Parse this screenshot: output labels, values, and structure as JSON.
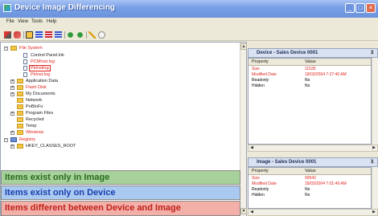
{
  "window": {
    "title": "Device Image Differencing",
    "minimize_glyph": "_",
    "maximize_glyph": "□",
    "close_glyph": "×"
  },
  "menu": [
    "File",
    "View",
    "Tools",
    "Help"
  ],
  "toolbar_icons": [
    "cut-icon",
    "undo-icon",
    "compare-icon",
    "view-list-icon",
    "view-detail-icon",
    "view-tree-icon",
    "sync-icon",
    "export-icon",
    "refresh-icon",
    "help-icon"
  ],
  "tree": {
    "items": [
      {
        "label": "File System",
        "kind": "folder",
        "level": 0,
        "expander": "−",
        "color": "red"
      },
      {
        "label": "Control Panel.lnk",
        "kind": "file",
        "level": 2,
        "color": "normal"
      },
      {
        "label": "PCMInst.log",
        "kind": "file",
        "level": 2,
        "color": "red"
      },
      {
        "label": "PkInstlog",
        "kind": "file",
        "level": 2,
        "color": "selected"
      },
      {
        "label": "PkInst.log",
        "kind": "file",
        "level": 2,
        "color": "red"
      },
      {
        "label": "Application Data",
        "kind": "folder",
        "level": 1,
        "expander": "+",
        "color": "normal"
      },
      {
        "label": "Flash Disk",
        "kind": "folder",
        "level": 1,
        "expander": "+",
        "color": "red"
      },
      {
        "label": "My Documents",
        "kind": "folder",
        "level": 1,
        "expander": "+",
        "color": "normal"
      },
      {
        "label": "Network",
        "kind": "folder",
        "level": 1,
        "color": "normal"
      },
      {
        "label": "PnBInFo",
        "kind": "folder",
        "level": 1,
        "color": "normal"
      },
      {
        "label": "Program Files",
        "kind": "folder",
        "level": 1,
        "expander": "+",
        "color": "normal"
      },
      {
        "label": "Recycled",
        "kind": "folder",
        "level": 1,
        "color": "normal"
      },
      {
        "label": "Temp",
        "kind": "folder",
        "level": 1,
        "color": "normal"
      },
      {
        "label": "Windows",
        "kind": "folder",
        "level": 1,
        "expander": "+",
        "color": "red"
      },
      {
        "label": "Registry",
        "kind": "registry",
        "level": 0,
        "expander": "−",
        "color": "red"
      },
      {
        "label": "HKEY_CLASSES_ROOT",
        "kind": "folder",
        "level": 1,
        "expander": "+",
        "color": "normal"
      }
    ]
  },
  "legend": {
    "image_only": "Items exist only in Image",
    "device_only": "Items exist only on Device",
    "different": "Items different between Device and Image"
  },
  "device_panel": {
    "title": "Device - Sales Device 0001",
    "pin": "⊻",
    "headers": [
      "Property",
      "Value"
    ],
    "rows": [
      {
        "property": "Size",
        "value": "11535",
        "color": "red"
      },
      {
        "property": "Modified Date",
        "value": "18/03/2004 7:27:40 AM",
        "color": "red"
      },
      {
        "property": "Readonly",
        "value": "No",
        "color": "normal"
      },
      {
        "property": "Hidden",
        "value": "No",
        "color": "normal"
      }
    ]
  },
  "image_panel": {
    "title": "Image - Sales Device 0001",
    "pin": "⊻",
    "headers": [
      "Property",
      "Value"
    ],
    "rows": [
      {
        "property": "Size",
        "value": "90942",
        "color": "red"
      },
      {
        "property": "Modified Date",
        "value": "18/03/2004 7:01:49 AM",
        "color": "red"
      },
      {
        "property": "Readonly",
        "value": "No",
        "color": "normal"
      },
      {
        "property": "Hidden",
        "value": "No",
        "color": "normal"
      }
    ]
  },
  "scroll_glyphs": {
    "up": "▲",
    "down": "▼",
    "left": "◀",
    "right": "▶"
  },
  "colors": {
    "red_text": "#e0241e",
    "legend_green": "#a6d19a",
    "legend_blue": "#a9c9f0",
    "legend_red": "#f2b0a8"
  }
}
